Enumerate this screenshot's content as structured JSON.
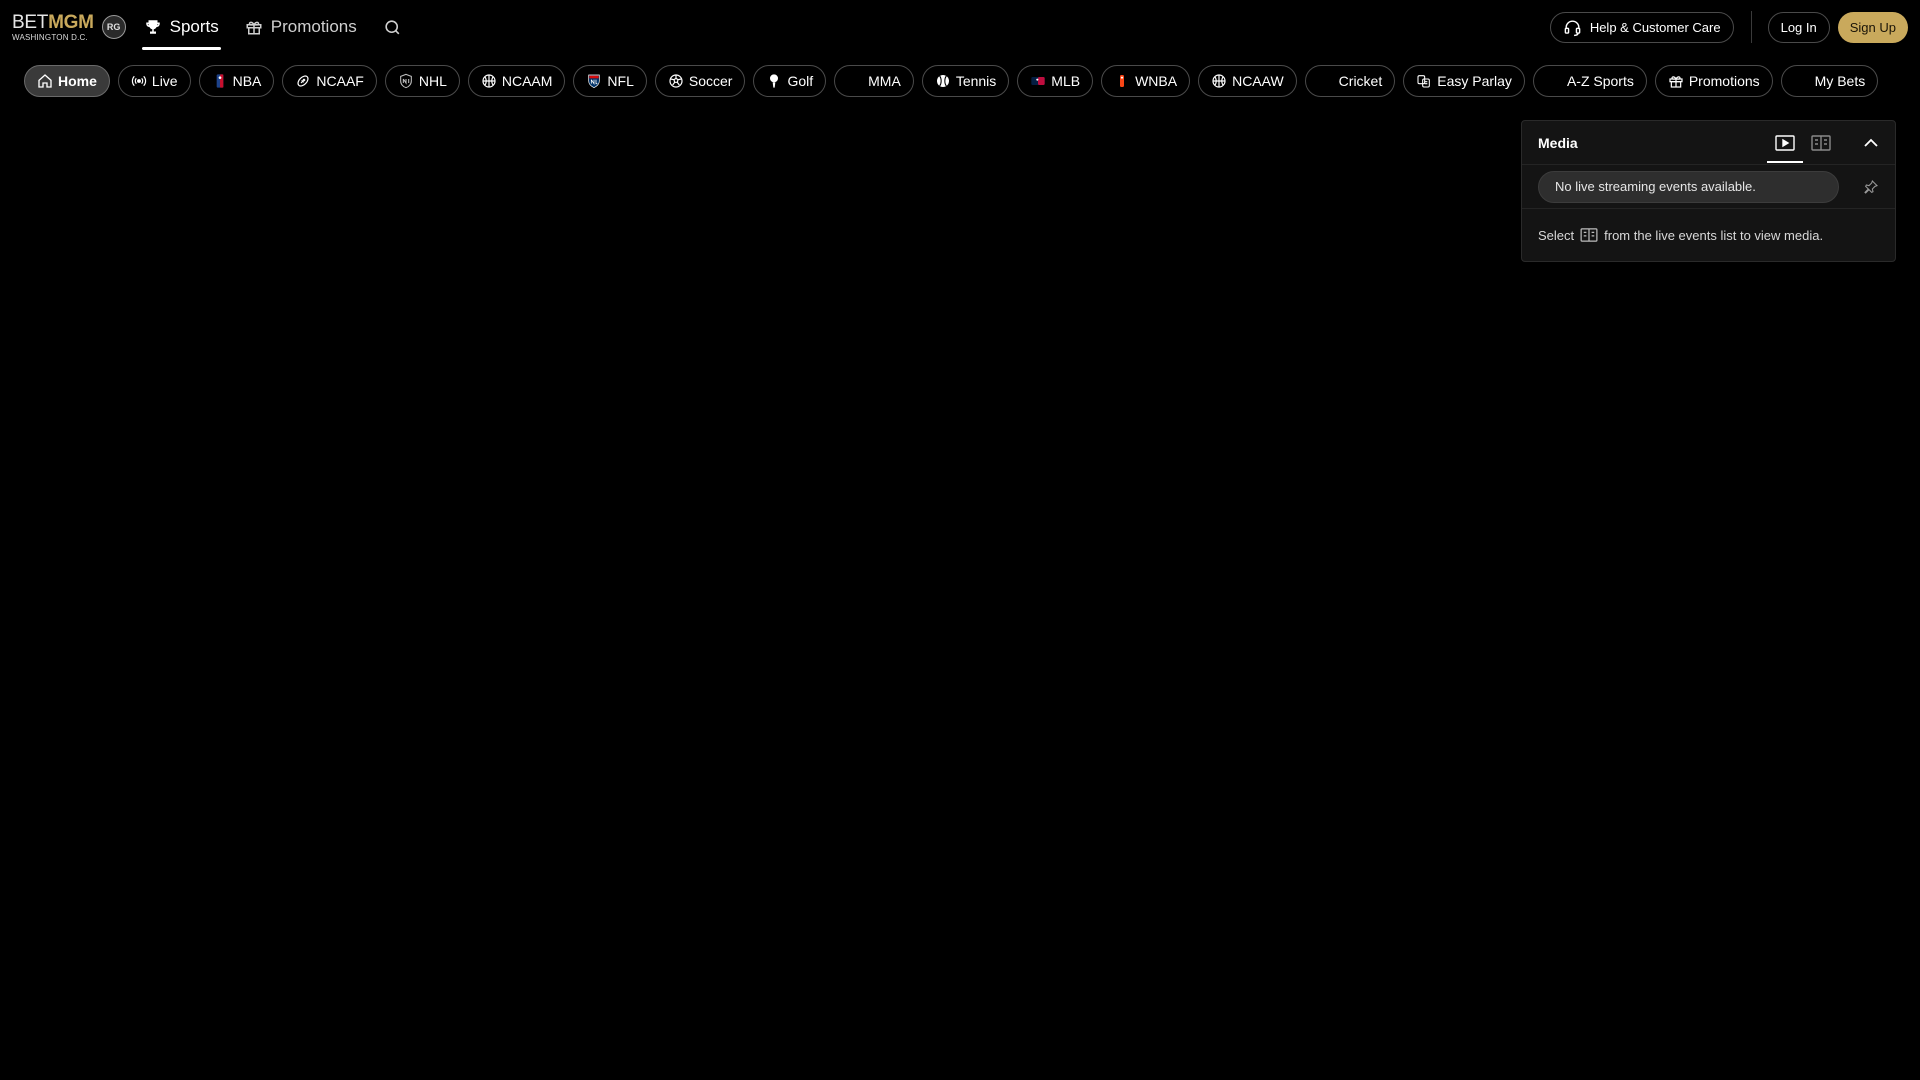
{
  "header": {
    "logo": {
      "bet": "BET",
      "mgm": "MGM",
      "region": "WASHINGTON D.C."
    },
    "rg_badge": "RG",
    "nav": [
      {
        "label": "Sports",
        "icon": "trophy-icon",
        "active": true
      },
      {
        "label": "Promotions",
        "icon": "gift-icon",
        "active": false
      }
    ],
    "search_icon": "search-icon",
    "help_label": "Help & Customer Care",
    "login_label": "Log In",
    "signup_label": "Sign Up"
  },
  "chips": [
    {
      "label": "Home",
      "icon": "home-icon",
      "active": true
    },
    {
      "label": "Live",
      "icon": "live-broadcast-icon"
    },
    {
      "label": "NBA",
      "icon": "nba-logo-icon"
    },
    {
      "label": "NCAAF",
      "icon": "football-icon"
    },
    {
      "label": "NHL",
      "icon": "nhl-logo-icon"
    },
    {
      "label": "NCAAM",
      "icon": "basketball-icon"
    },
    {
      "label": "NFL",
      "icon": "nfl-logo-icon"
    },
    {
      "label": "Soccer",
      "icon": "soccer-ball-icon"
    },
    {
      "label": "Golf",
      "icon": "golf-tee-icon"
    },
    {
      "label": "MMA",
      "icon": "none"
    },
    {
      "label": "Tennis",
      "icon": "tennis-ball-icon"
    },
    {
      "label": "MLB",
      "icon": "mlb-logo-icon"
    },
    {
      "label": "WNBA",
      "icon": "wnba-logo-icon"
    },
    {
      "label": "NCAAW",
      "icon": "basketball-icon"
    },
    {
      "label": "Cricket",
      "icon": "none"
    },
    {
      "label": "Easy Parlay",
      "icon": "parlay-icon"
    },
    {
      "label": "A-Z Sports",
      "icon": "none"
    },
    {
      "label": "Promotions",
      "icon": "gift-icon"
    },
    {
      "label": "My Bets",
      "icon": "none"
    }
  ],
  "media": {
    "title": "Media",
    "select_value": "No live streaming events available.",
    "hint_before": "Select",
    "hint_after": "from the live events list to view media."
  },
  "colors": {
    "background": "#000000",
    "accent_gold": "#c9a95c",
    "chip_border": "#4a4a4a",
    "panel_bg": "#141414"
  }
}
